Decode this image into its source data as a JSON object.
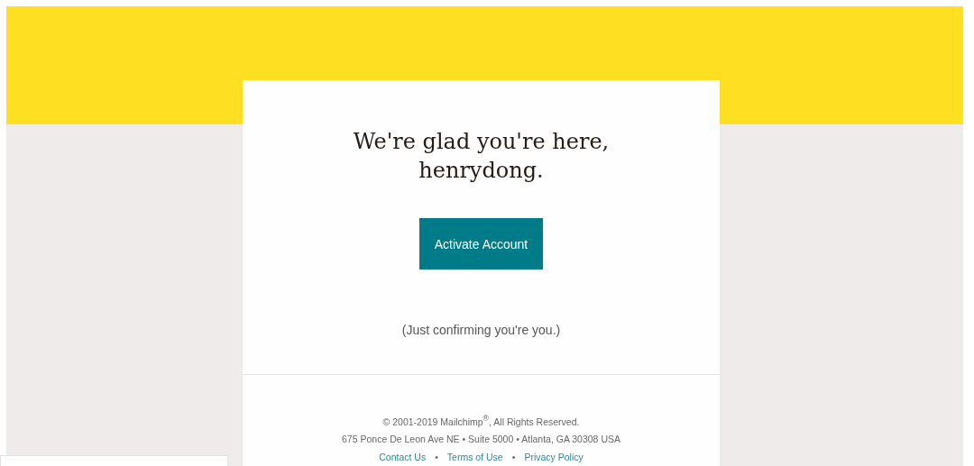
{
  "heading": [
    "We're glad you're here,",
    "henrydong."
  ],
  "button": {
    "label": "Activate Account"
  },
  "note": "(Just confirming you're you.)",
  "footer": {
    "copyright": "© 2001-2019 Mailchimp$^{®}$, All Rights Reserved.",
    "address": "675 Ponce De Leon Ave NE • Suite 5000 • Atlanta, GA 30308 USA",
    "links": [
      "Contact Us",
      "Terms of Use",
      "Privacy Policy"
    ],
    "separator": "•"
  }
}
